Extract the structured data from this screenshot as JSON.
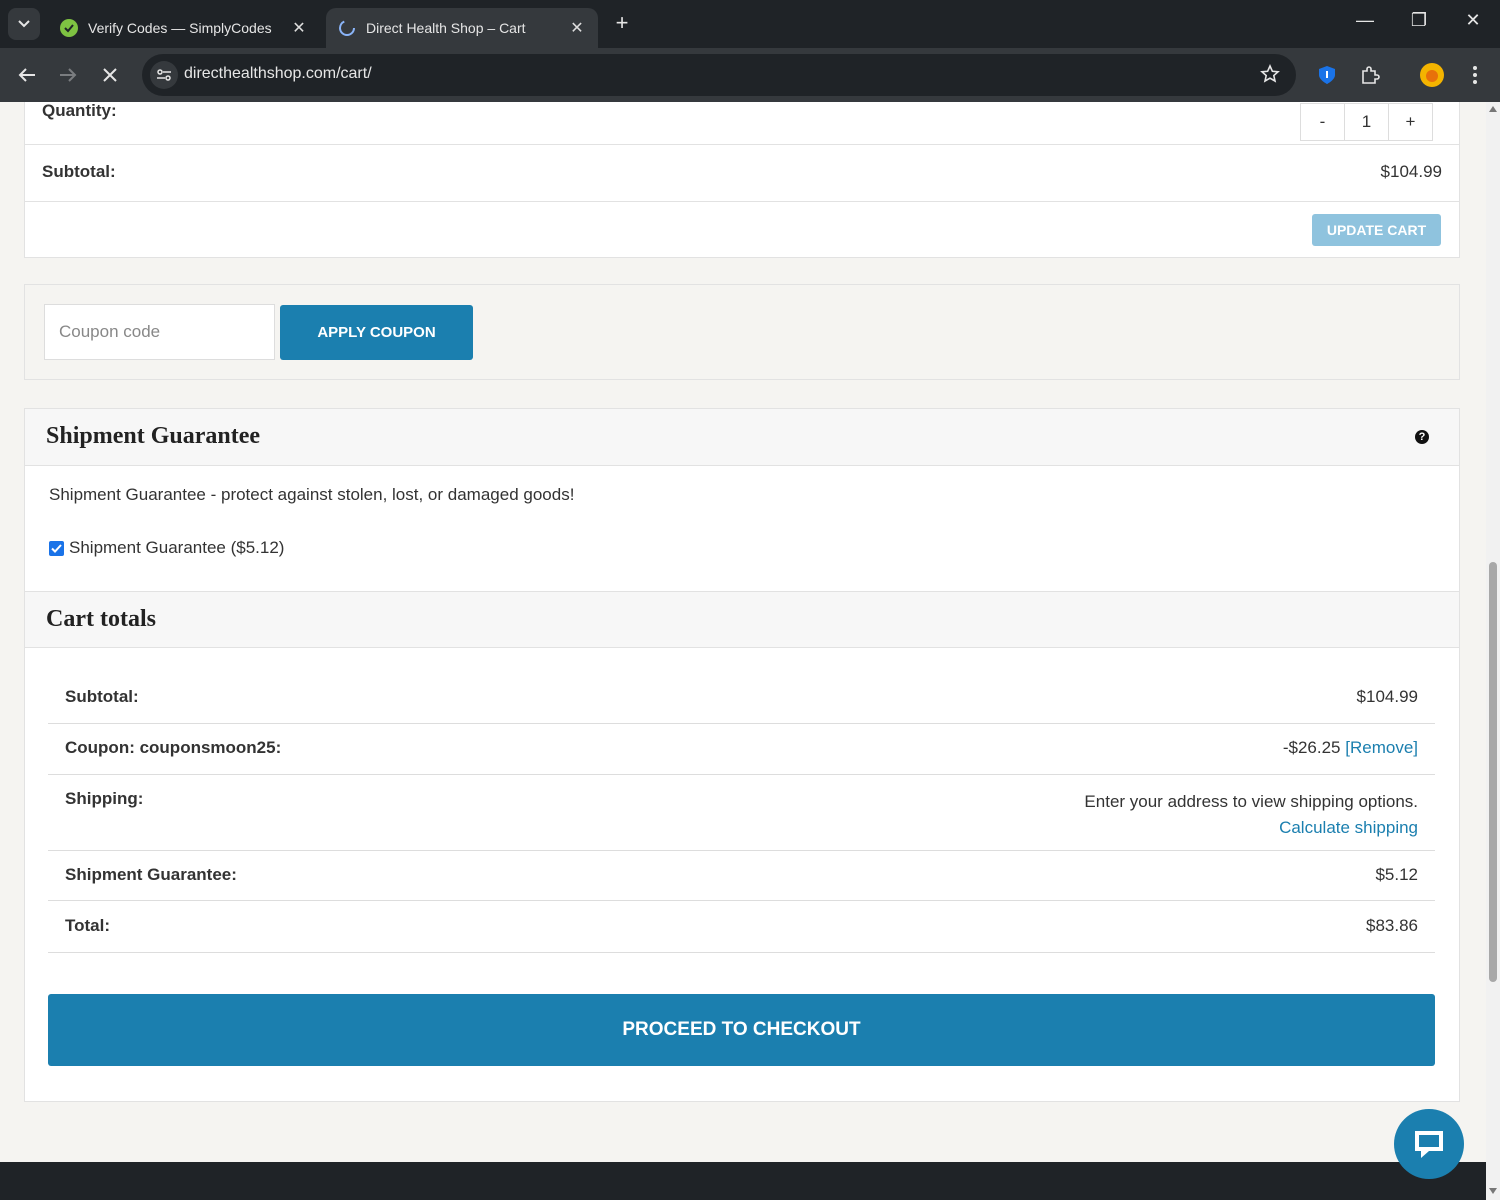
{
  "browser": {
    "tabs": [
      {
        "title": "Verify Codes — SimplyCodes",
        "active": false
      },
      {
        "title": "Direct Health Shop – Cart",
        "active": true
      }
    ],
    "url": "directhealthshop.com/cart/"
  },
  "cart": {
    "quantity_label": "Quantity:",
    "quantity_minus": "-",
    "quantity_value": "1",
    "quantity_plus": "+",
    "subtotal_label": "Subtotal:",
    "subtotal_value": "$104.99",
    "update_button": "UPDATE CART"
  },
  "coupon": {
    "placeholder": "Coupon code",
    "apply_button": "APPLY COUPON"
  },
  "shipment_guarantee": {
    "heading": "Shipment Guarantee",
    "help_icon": "?",
    "description": "Shipment Guarantee - protect against stolen, lost, or damaged goods!",
    "checkbox_label": "Shipment Guarantee ($5.12)",
    "checked": true
  },
  "cart_totals": {
    "heading": "Cart totals",
    "rows": [
      {
        "label": "Subtotal:",
        "value": "$104.99"
      },
      {
        "label": "Coupon: couponsmoon25:",
        "value": "-$26.25",
        "link": "[Remove]"
      },
      {
        "label": "Shipping:",
        "value": "Enter your address to view shipping options.",
        "link": "Calculate shipping"
      },
      {
        "label": "Shipment Guarantee:",
        "value": "$5.12"
      },
      {
        "label": "Total:",
        "value": "$83.86"
      }
    ],
    "checkout_button": "PROCEED TO CHECKOUT"
  },
  "colors": {
    "accent": "#1b7faf",
    "update_disabled": "#8fc3de",
    "chrome_dark": "#1f2327"
  }
}
